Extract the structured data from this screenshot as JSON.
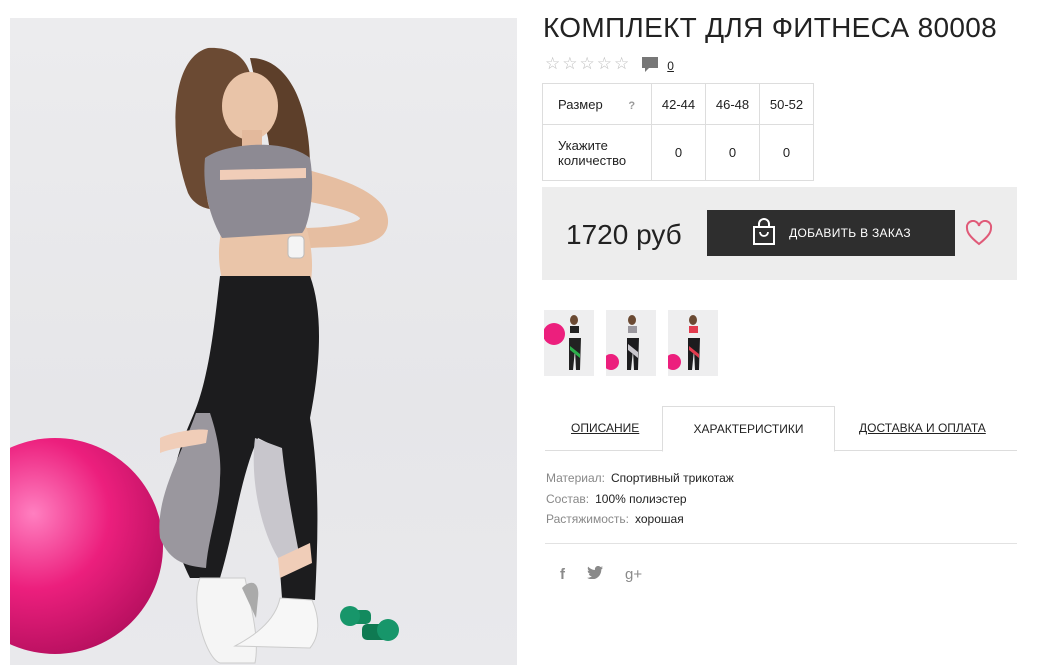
{
  "product": {
    "title": "КОМПЛЕКТ ДЛЯ ФИТНЕСА 80008",
    "rating_stars": 0,
    "comment_count": "0",
    "price": "1720 руб",
    "add_button_label": "ДОБАВИТЬ В ЗАКАЗ"
  },
  "size_table": {
    "size_label": "Размер",
    "help_mark": "?",
    "quantity_label": "Укажите количество",
    "sizes": [
      "42-44",
      "46-48",
      "50-52"
    ],
    "quantities": [
      "0",
      "0",
      "0"
    ]
  },
  "thumbnails": [
    {
      "name": "green-set",
      "accent": "#2db04b"
    },
    {
      "name": "grey-set",
      "accent": "#b9b9bd"
    },
    {
      "name": "red-set",
      "accent": "#e23b4e"
    }
  ],
  "tabs": [
    {
      "label": "ОПИСАНИЕ",
      "active": false
    },
    {
      "label": "ХАРАКТЕРИСТИКИ",
      "active": true
    },
    {
      "label": "ДОСТАВКА И ОПЛАТА",
      "active": false
    }
  ],
  "specs": [
    {
      "label": "Материал:",
      "value": "Спортивный трикотаж"
    },
    {
      "label": "Состав:",
      "value": "100% полиэстер"
    },
    {
      "label": "Растяжимость:",
      "value": "хорошая"
    }
  ],
  "social": [
    "facebook-icon",
    "twitter-icon",
    "google-plus-icon"
  ],
  "social_glyphs": {
    "facebook": "f",
    "twitter": "🐦",
    "google_plus": "g+"
  },
  "colors": {
    "button": "#2e2e2e",
    "heart": "#e05a78",
    "ball": "#ec1f7d",
    "dumbbell": "#138a5e"
  }
}
